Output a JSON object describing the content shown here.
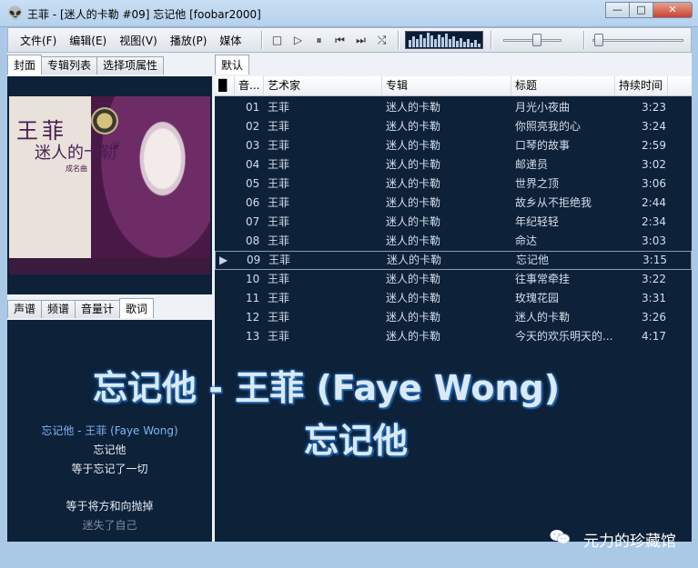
{
  "window": {
    "title": "王菲 - [迷人的卡勒 #09] 忘记他  [foobar2000]",
    "app_icon": "alien-head-icon",
    "buttons": [
      "—",
      "□",
      "✕"
    ]
  },
  "menu": [
    "文件(F)",
    "编辑(E)",
    "视图(V)",
    "播放(P)",
    "媒体"
  ],
  "transport": {
    "buttons": [
      "stop-icon",
      "play-icon",
      "pause-icon",
      "previous-icon",
      "next-icon",
      "random-icon"
    ],
    "glyphs": [
      "□",
      "▷",
      "⏸",
      "⏮",
      "⏭",
      "⤭"
    ]
  },
  "left_tabs": [
    "封面",
    "专辑列表",
    "选择项属性"
  ],
  "album_art": {
    "artist_text": "王菲",
    "album_text": "迷人的卡勒",
    "tag_text": "成名曲"
  },
  "bottom_tabs": [
    "声谱",
    "频谱",
    "音量计",
    "歌词"
  ],
  "lyrics": {
    "lines": [
      "忘记他 - 王菲 (Faye Wong)",
      "忘记他",
      "等于忘记了一切",
      "",
      "等于将方和向抛掉",
      "迷失了自己"
    ]
  },
  "playlist": {
    "tab": "默认",
    "columns": [
      "█",
      "音...",
      "艺术家",
      "专辑",
      "标题",
      "持续时间"
    ],
    "playing_index": 8,
    "tracks": [
      {
        "no": "01",
        "artist": "王菲",
        "album": "迷人的卡勒",
        "title": "月光小夜曲",
        "duration": "3:23"
      },
      {
        "no": "02",
        "artist": "王菲",
        "album": "迷人的卡勒",
        "title": "你照亮我的心",
        "duration": "3:24"
      },
      {
        "no": "03",
        "artist": "王菲",
        "album": "迷人的卡勒",
        "title": "口琴的故事",
        "duration": "2:59"
      },
      {
        "no": "04",
        "artist": "王菲",
        "album": "迷人的卡勒",
        "title": "邮递员",
        "duration": "3:02"
      },
      {
        "no": "05",
        "artist": "王菲",
        "album": "迷人的卡勒",
        "title": "世界之顶",
        "duration": "3:06"
      },
      {
        "no": "06",
        "artist": "王菲",
        "album": "迷人的卡勒",
        "title": "故乡从不拒绝我",
        "duration": "2:44"
      },
      {
        "no": "07",
        "artist": "王菲",
        "album": "迷人的卡勒",
        "title": "年纪轻轻",
        "duration": "2:34"
      },
      {
        "no": "08",
        "artist": "王菲",
        "album": "迷人的卡勒",
        "title": "命达",
        "duration": "3:03"
      },
      {
        "no": "09",
        "artist": "王菲",
        "album": "迷人的卡勒",
        "title": "忘记他",
        "duration": "3:15"
      },
      {
        "no": "10",
        "artist": "王菲",
        "album": "迷人的卡勒",
        "title": "往事常牵挂",
        "duration": "3:22"
      },
      {
        "no": "11",
        "artist": "王菲",
        "album": "迷人的卡勒",
        "title": "玫瑰花园",
        "duration": "3:31"
      },
      {
        "no": "12",
        "artist": "王菲",
        "album": "迷人的卡勒",
        "title": "迷人的卡勒",
        "duration": "3:26"
      },
      {
        "no": "13",
        "artist": "王菲",
        "album": "迷人的卡勒",
        "title": "今天的欢乐明天的...",
        "duration": "4:17"
      }
    ]
  },
  "overlay_lyrics": {
    "line1": "忘记他 - 王菲 (Faye Wong)",
    "line2": "忘记他"
  },
  "volume_level": 0.6,
  "seek_position": 0.02,
  "visualizer_levels": [
    0.45,
    0.7,
    0.55,
    0.85,
    0.6,
    0.95,
    0.75,
    0.5,
    0.8,
    0.65,
    0.9,
    0.55,
    0.7,
    0.4,
    0.6,
    0.35,
    0.5,
    0.3,
    0.45,
    0.25
  ],
  "watermark": "元力的珍藏馆",
  "colors": {
    "list_bg": "#0d2139",
    "overlay_glow": "#2a79c9",
    "lyric_highlight": "#7fb6f0"
  }
}
